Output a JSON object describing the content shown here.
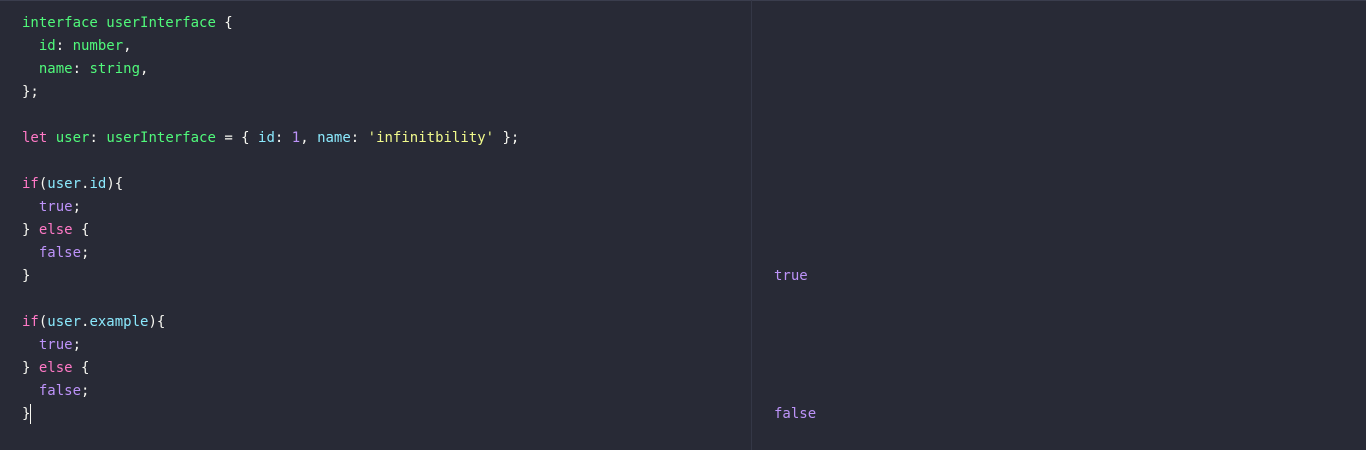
{
  "editor": {
    "lines": [
      [
        {
          "t": "interface",
          "c": "kw-green"
        },
        {
          "t": " ",
          "c": "punc"
        },
        {
          "t": "userInterface",
          "c": "ident-green"
        },
        {
          "t": " {",
          "c": "punc"
        }
      ],
      [
        {
          "t": "  ",
          "c": "punc"
        },
        {
          "t": "id",
          "c": "ident-green"
        },
        {
          "t": ": ",
          "c": "punc"
        },
        {
          "t": "number",
          "c": "ident-green"
        },
        {
          "t": ",",
          "c": "punc"
        }
      ],
      [
        {
          "t": "  ",
          "c": "punc"
        },
        {
          "t": "name",
          "c": "ident-green"
        },
        {
          "t": ": ",
          "c": "punc"
        },
        {
          "t": "string",
          "c": "ident-green"
        },
        {
          "t": ",",
          "c": "punc"
        }
      ],
      [
        {
          "t": "};",
          "c": "punc"
        }
      ],
      [],
      [
        {
          "t": "let",
          "c": "kw-pink"
        },
        {
          "t": " ",
          "c": "punc"
        },
        {
          "t": "user",
          "c": "ident-green"
        },
        {
          "t": ": ",
          "c": "punc"
        },
        {
          "t": "userInterface",
          "c": "ident-green"
        },
        {
          "t": " = { ",
          "c": "punc"
        },
        {
          "t": "id",
          "c": "prop"
        },
        {
          "t": ": ",
          "c": "punc"
        },
        {
          "t": "1",
          "c": "num"
        },
        {
          "t": ", ",
          "c": "punc"
        },
        {
          "t": "name",
          "c": "prop"
        },
        {
          "t": ": ",
          "c": "punc"
        },
        {
          "t": "'infinitbility'",
          "c": "str"
        },
        {
          "t": " };",
          "c": "punc"
        }
      ],
      [],
      [
        {
          "t": "if",
          "c": "kw-pink"
        },
        {
          "t": "(",
          "c": "punc"
        },
        {
          "t": "user",
          "c": "var"
        },
        {
          "t": ".",
          "c": "punc"
        },
        {
          "t": "id",
          "c": "prop"
        },
        {
          "t": "){",
          "c": "punc"
        }
      ],
      [
        {
          "t": "  ",
          "c": "punc"
        },
        {
          "t": "true",
          "c": "bool"
        },
        {
          "t": ";",
          "c": "punc"
        }
      ],
      [
        {
          "t": "} ",
          "c": "punc"
        },
        {
          "t": "else",
          "c": "kw-pink"
        },
        {
          "t": " {",
          "c": "punc"
        }
      ],
      [
        {
          "t": "  ",
          "c": "punc"
        },
        {
          "t": "false",
          "c": "bool"
        },
        {
          "t": ";",
          "c": "punc"
        }
      ],
      [
        {
          "t": "}",
          "c": "punc"
        }
      ],
      [],
      [
        {
          "t": "if",
          "c": "kw-pink"
        },
        {
          "t": "(",
          "c": "punc"
        },
        {
          "t": "user",
          "c": "var"
        },
        {
          "t": ".",
          "c": "punc"
        },
        {
          "t": "example",
          "c": "prop"
        },
        {
          "t": "){",
          "c": "punc"
        }
      ],
      [
        {
          "t": "  ",
          "c": "punc"
        },
        {
          "t": "true",
          "c": "bool"
        },
        {
          "t": ";",
          "c": "punc"
        }
      ],
      [
        {
          "t": "} ",
          "c": "punc"
        },
        {
          "t": "else",
          "c": "kw-pink"
        },
        {
          "t": " {",
          "c": "punc"
        }
      ],
      [
        {
          "t": "  ",
          "c": "punc"
        },
        {
          "t": "false",
          "c": "bool"
        },
        {
          "t": ";",
          "c": "punc"
        }
      ],
      [
        {
          "t": "}",
          "c": "punc"
        }
      ]
    ],
    "cursor_line": 17
  },
  "output": {
    "lines": [
      "",
      "",
      "",
      "",
      "",
      "",
      "",
      "",
      "",
      "",
      "",
      "true",
      "",
      "",
      "",
      "",
      "",
      "false"
    ]
  },
  "colors": {
    "background": "#282a36",
    "green": "#50fa7b",
    "pink": "#ff79c6",
    "cyan": "#8be9fd",
    "purple": "#bd93f9",
    "yellow": "#f1fa8c",
    "foreground": "#f8f8f2"
  }
}
